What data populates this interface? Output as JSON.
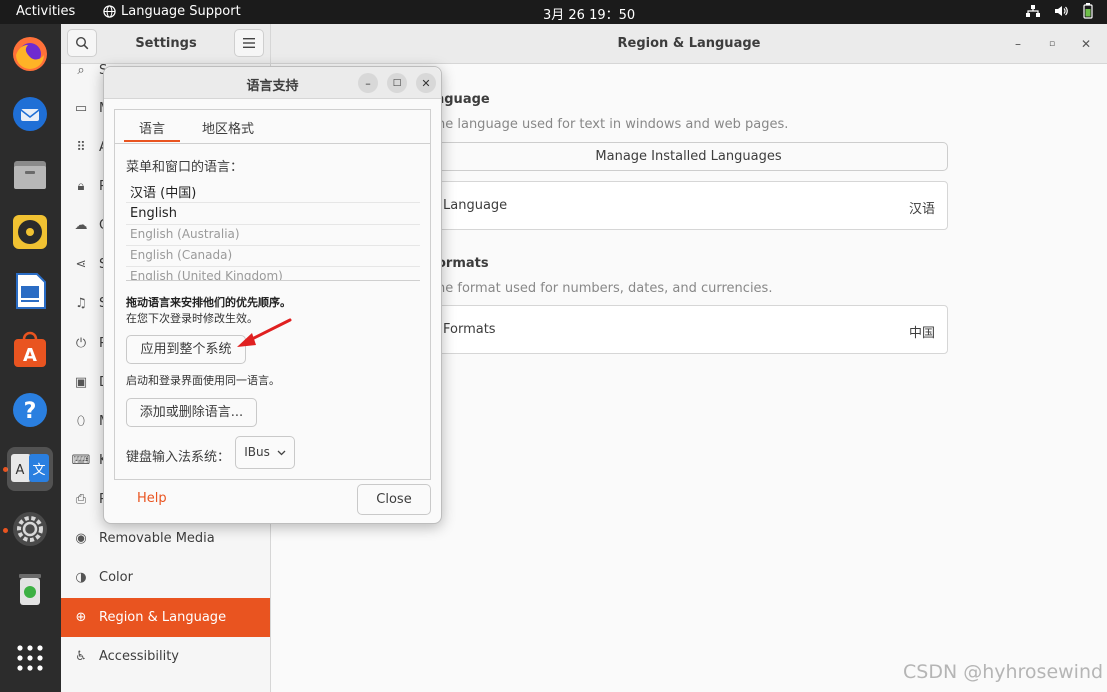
{
  "topbar": {
    "activities": "Activities",
    "app_name": "Language Support",
    "clock": "3月 26  19：50"
  },
  "settings": {
    "sidebar_title": "Settings",
    "panel_title": "Region & Language",
    "sidebar_items": [
      {
        "label": "Se",
        "icon": "search-icon"
      },
      {
        "label": "M",
        "icon": "monitor-icon"
      },
      {
        "label": "A",
        "icon": "grid-icon"
      },
      {
        "label": "P",
        "icon": "lock-icon"
      },
      {
        "label": "O",
        "icon": "cloud-icon"
      },
      {
        "label": "S",
        "icon": "share-icon"
      },
      {
        "label": "S",
        "icon": "music-icon"
      },
      {
        "label": "P",
        "icon": "power-icon"
      },
      {
        "label": "D",
        "icon": "display-icon"
      },
      {
        "label": "M",
        "icon": "mouse-icon"
      },
      {
        "label": "K",
        "icon": "keyboard-icon"
      },
      {
        "label": "P",
        "icon": "printer-icon"
      },
      {
        "label": "Removable Media",
        "icon": "media-icon"
      },
      {
        "label": "Color",
        "icon": "color-icon"
      },
      {
        "label": "Region & Language",
        "icon": "globe-icon"
      },
      {
        "label": "Accessibility",
        "icon": "accessibility-icon"
      }
    ],
    "language_section_title": "nguage",
    "language_section_desc": "ne language used for text in windows and web pages.",
    "manage_button": "Manage Installed Languages",
    "language_row_label": "Language",
    "language_row_value": "汉语",
    "formats_section_title": "ormats",
    "formats_section_desc": "ne format used for numbers, dates, and currencies.",
    "formats_row_label": "Formats",
    "formats_row_value": "中国"
  },
  "dialog": {
    "title": "语言支持",
    "tabs": [
      "语言",
      "地区格式"
    ],
    "menu_language_label": "菜单和窗口的语言：",
    "languages": [
      "汉语 (中国)",
      "English",
      "English (Australia)",
      "English (Canada)",
      "English (United Kingdom)"
    ],
    "drag_hint": "拖动语言来安排他们的优先顺序。",
    "next_login_hint": "在您下次登录时修改生效。",
    "apply_button": "应用到整个系统",
    "same_lang_hint": "启动和登录界面使用同一语言。",
    "add_remove_button": "添加或删除语言...",
    "im_label": "键盘输入法系统：",
    "im_value": "IBus",
    "help_button": "Help",
    "close_button": "Close"
  },
  "watermark": "CSDN @hyhrosewind",
  "colors": {
    "accent": "#e95420",
    "arrow": "#e02020"
  }
}
